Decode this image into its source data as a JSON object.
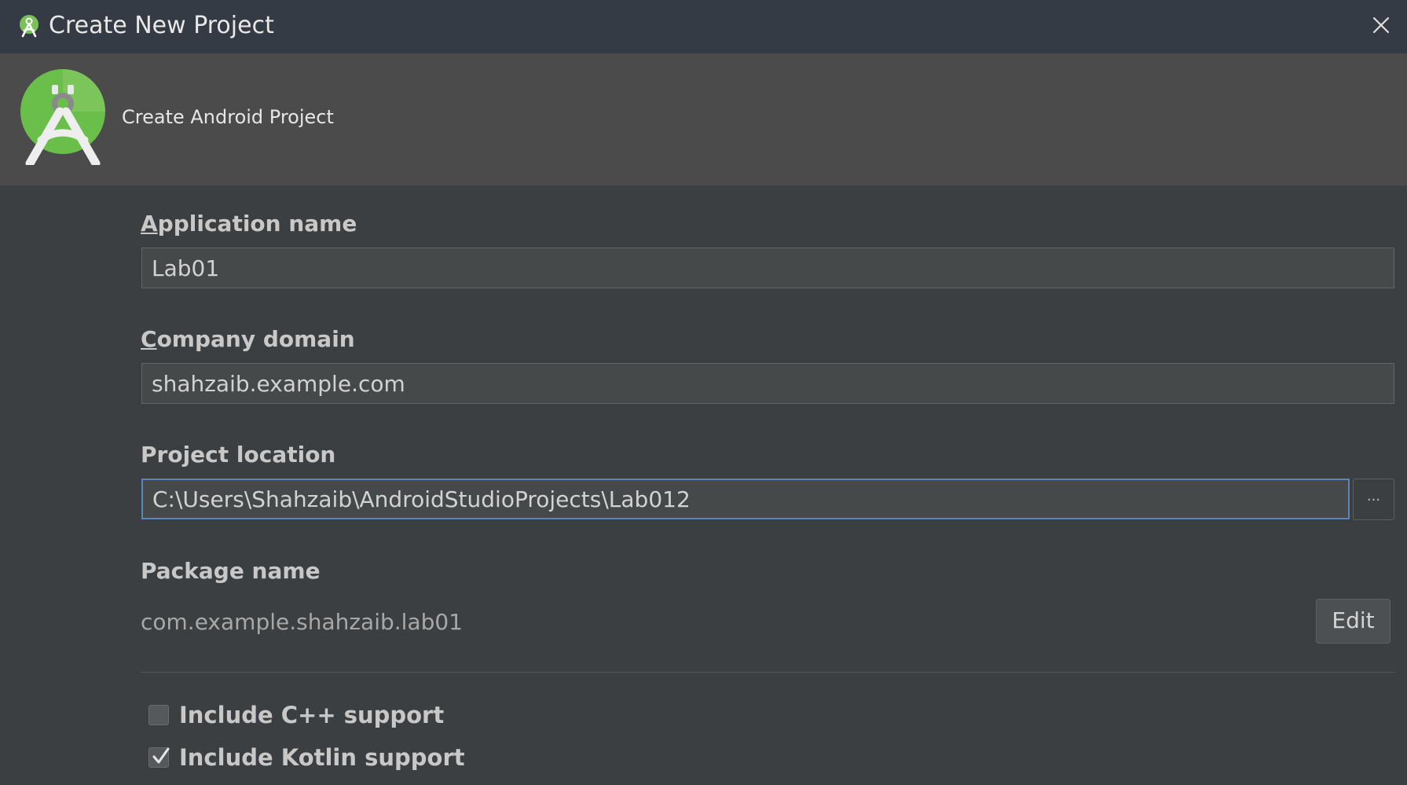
{
  "window": {
    "title": "Create New Project"
  },
  "header": {
    "subtitle": "Create Android Project"
  },
  "form": {
    "application_name": {
      "label_mnemonic": "A",
      "label_rest": "pplication name",
      "value": "Lab01"
    },
    "company_domain": {
      "label_mnemonic": "C",
      "label_rest": "ompany domain",
      "value": "shahzaib.example.com"
    },
    "project_location": {
      "label": "Project location",
      "value": "C:\\Users\\Shahzaib\\AndroidStudioProjects\\Lab012",
      "browse_label": "..."
    },
    "package_name": {
      "label": "Package name",
      "value": "com.example.shahzaib.lab01",
      "edit_label": "Edit"
    },
    "options": [
      {
        "label": "Include C++ support",
        "checked": false
      },
      {
        "label": "Include Kotlin support",
        "checked": true
      }
    ]
  },
  "icons": {
    "app": "android-studio-icon",
    "close": "close-icon",
    "check": "checkmark-icon"
  },
  "colors": {
    "titlebar": "#353b45",
    "header": "#4b4b4b",
    "background": "#3c3f41",
    "focus_border": "#5a85bb",
    "logo_green": "#78c257"
  }
}
